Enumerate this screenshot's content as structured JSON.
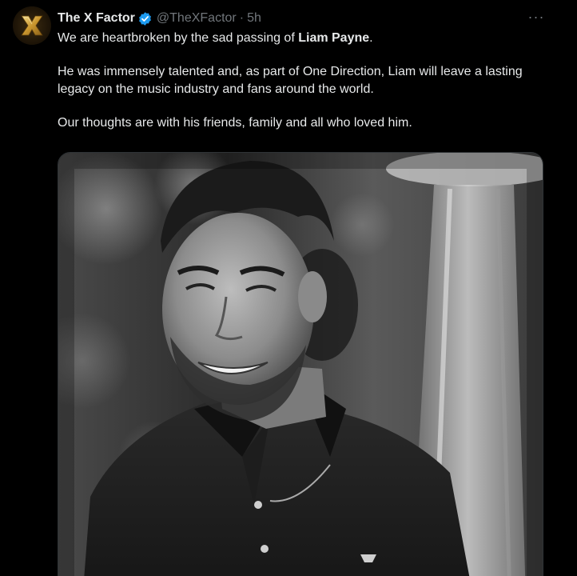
{
  "account": {
    "display_name": "The X Factor",
    "handle": "@TheXFactor",
    "separator": "·",
    "time_ago": "5h",
    "avatar_icon": "x-factor-logo-icon",
    "verified_icon": "verified-badge-icon",
    "verified_color": "#1d9bf0"
  },
  "tweet": {
    "line1_prefix": "We are heartbroken by the sad passing of ",
    "line1_bold": "Liam Payne",
    "line1_suffix": ".",
    "paragraph2": "He was immensely talented and, as part of One Direction, Liam will leave a lasting legacy on the music industry and fans around the world.",
    "paragraph3": "Our thoughts are with his friends, family and all who loved him."
  },
  "menu": {
    "more_icon": "more-options-icon",
    "more_glyph": "···"
  },
  "media": {
    "type": "photo",
    "style": "black-and-white",
    "subject": "smiling man in dark polo shirt"
  },
  "colors": {
    "background": "#000000",
    "text": "#e7e9ea",
    "muted": "#71767b",
    "border": "#2f3336"
  }
}
